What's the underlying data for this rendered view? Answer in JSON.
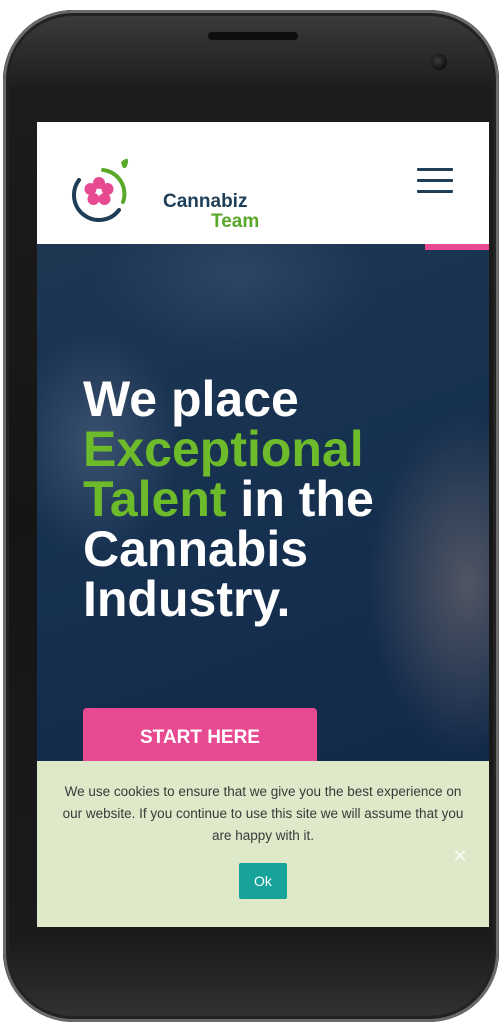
{
  "logo": {
    "line1": "Cannabiz",
    "line2": "Team",
    "icon": "cannabis-flower-logo-icon",
    "colors": {
      "navy": "#1f3e57",
      "green": "#5aa82a",
      "pink": "#e84a92"
    }
  },
  "header": {
    "menu_icon": "hamburger-menu-icon"
  },
  "hero": {
    "title_parts": [
      {
        "text": "We place ",
        "highlight": false
      },
      {
        "text": "Exceptional Talent",
        "highlight": true
      },
      {
        "text": " in the Cannabis Industry.",
        "highlight": false
      }
    ],
    "cta_label": "START HERE",
    "accent_green": "#6dbb2a",
    "accent_pink": "#e84a92"
  },
  "cookie": {
    "message": "We use cookies to ensure that we give you the best experience on our website. If you continue to use this site we will assume that you are happy with it.",
    "ok_label": "Ok",
    "close_icon": "close-icon",
    "background": "#dde9c8",
    "button_color": "#17a39a"
  }
}
